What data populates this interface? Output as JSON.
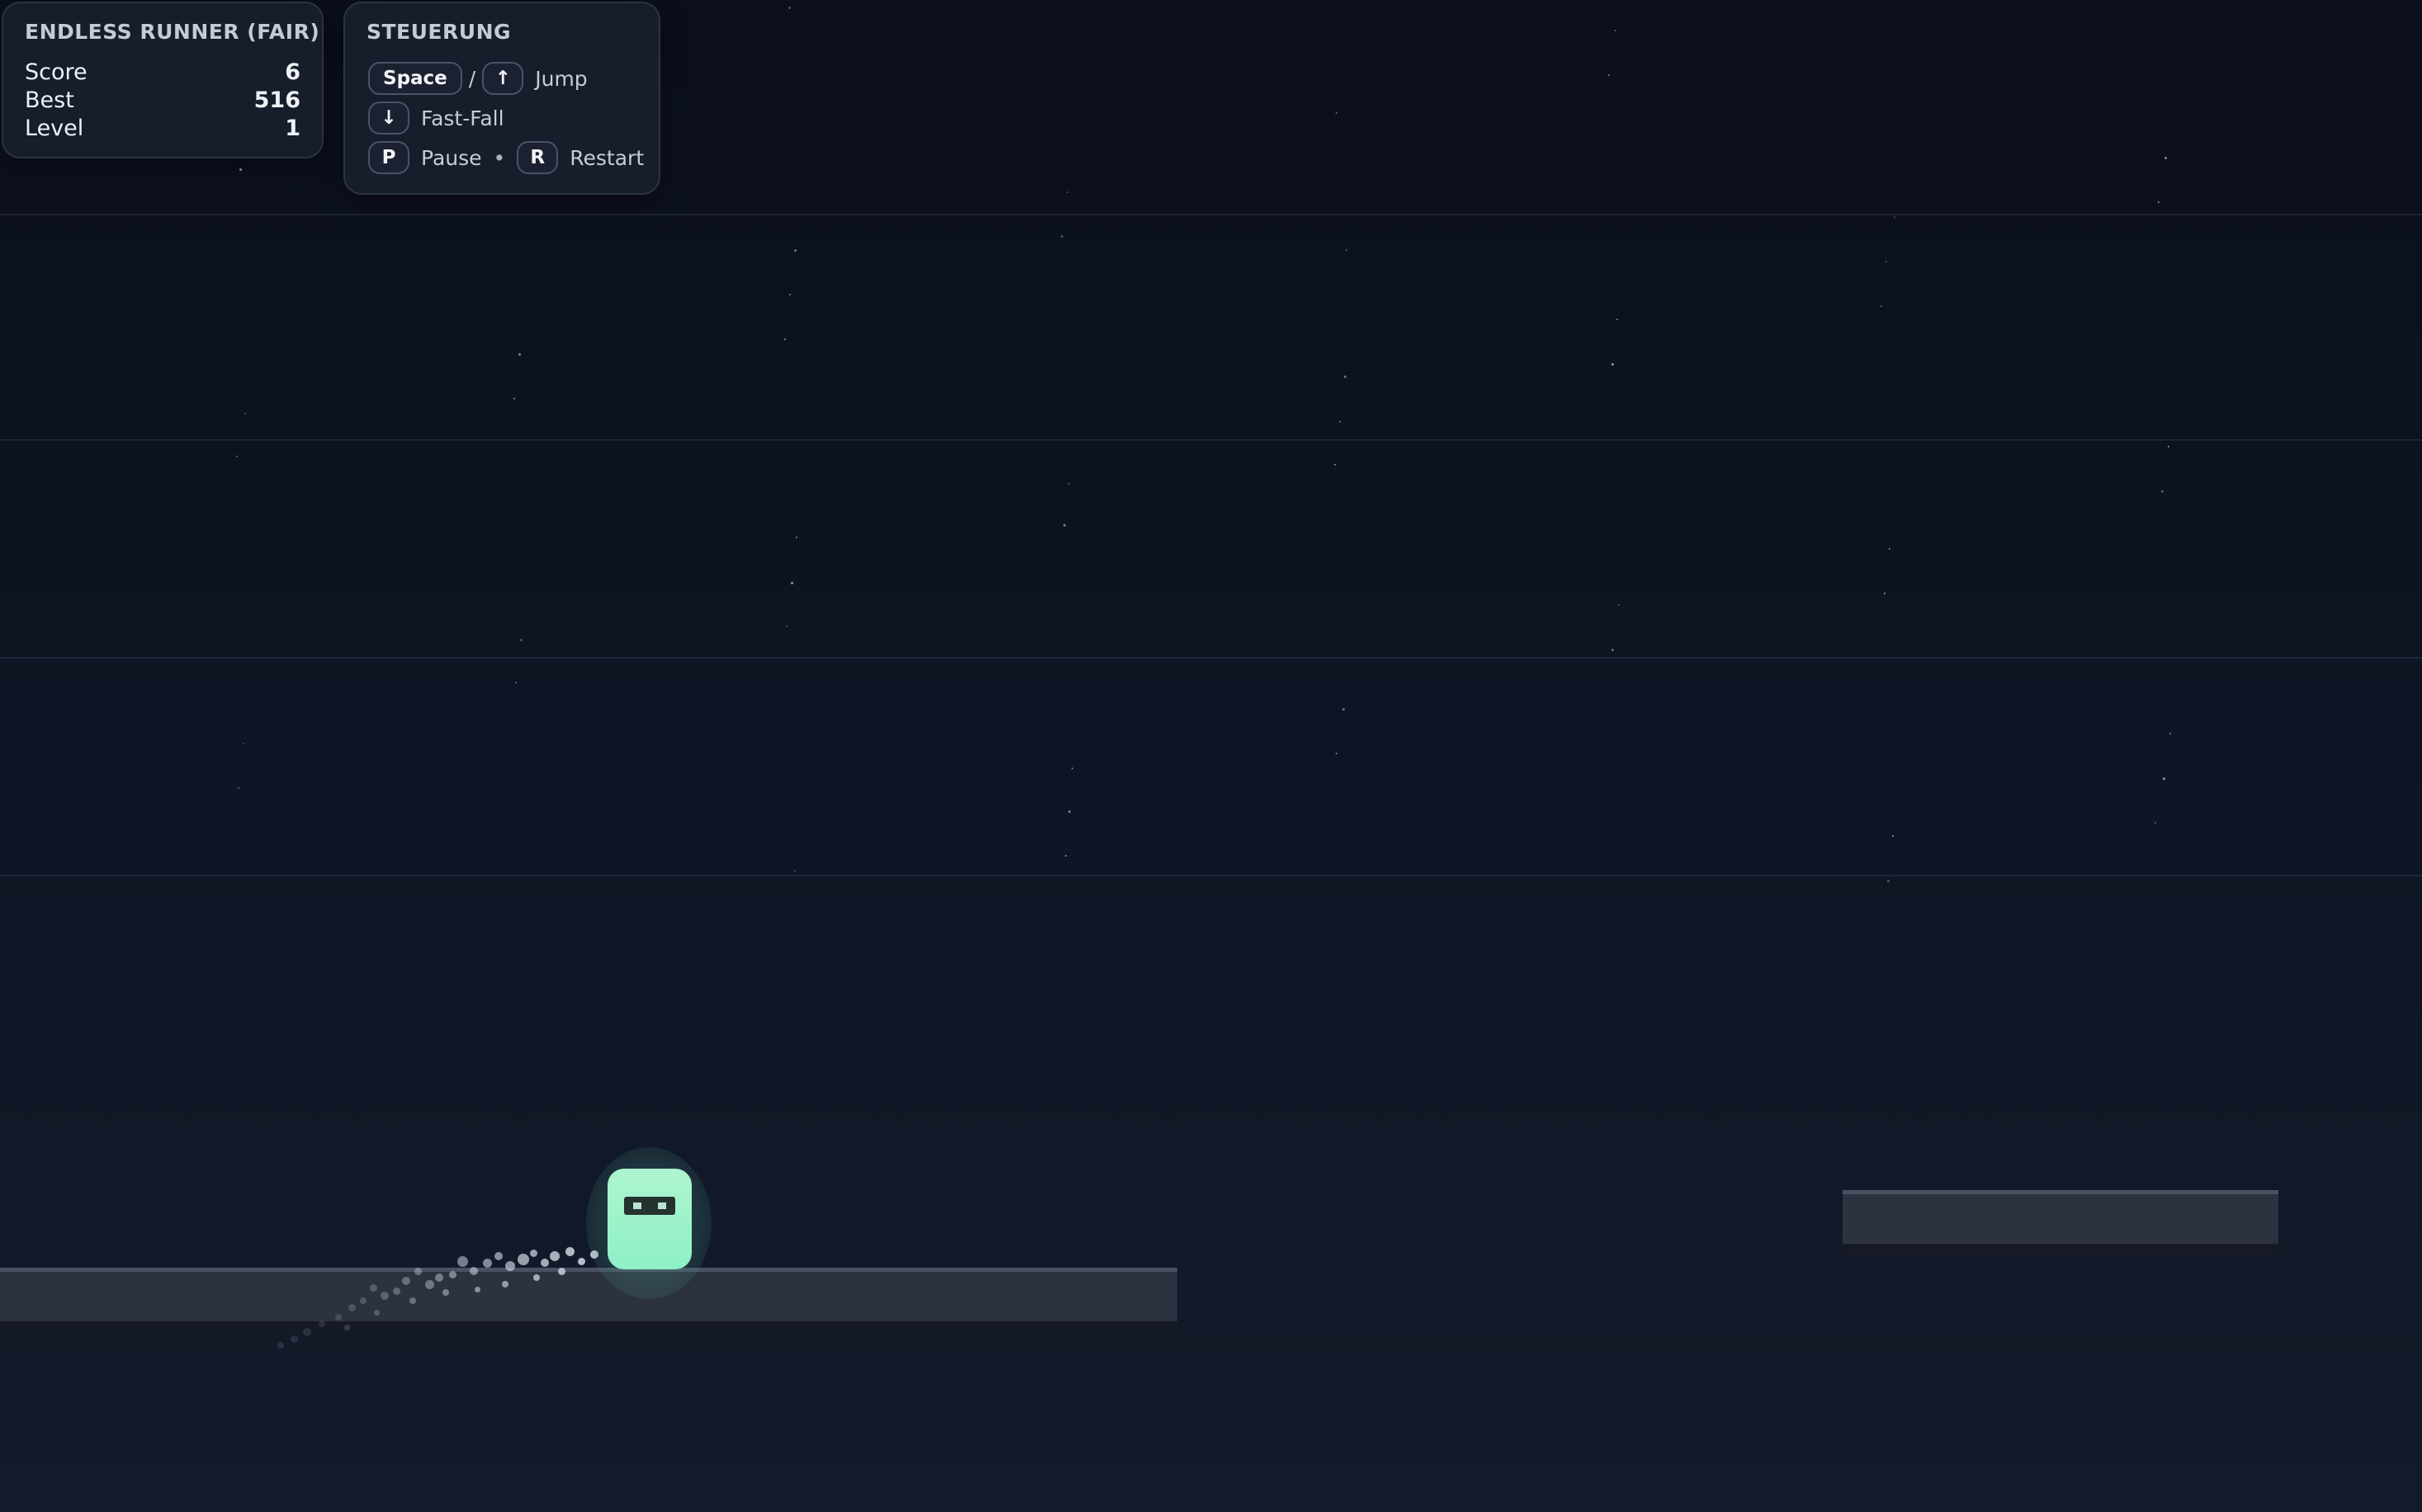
{
  "game": {
    "title": "ENDLESS RUNNER (FAIR)",
    "stats": [
      {
        "label": "Score",
        "value": "6"
      },
      {
        "label": "Best",
        "value": "516"
      },
      {
        "label": "Level",
        "value": "1"
      }
    ]
  },
  "controls": {
    "title": "STEUERUNG",
    "space_key": "Space",
    "slash": "/",
    "up_key": "↑",
    "jump_label": "Jump",
    "down_key": "↓",
    "fastfall_label": "Fast-Fall",
    "pause_key": "P",
    "pause_label": "Pause",
    "dot": "•",
    "restart_key": "R",
    "restart_label": "Restart"
  },
  "colors": {
    "background": "#0b0f1a",
    "player": "#8ef0c6",
    "platform": "#2c3240",
    "panel": "#181e2c"
  }
}
